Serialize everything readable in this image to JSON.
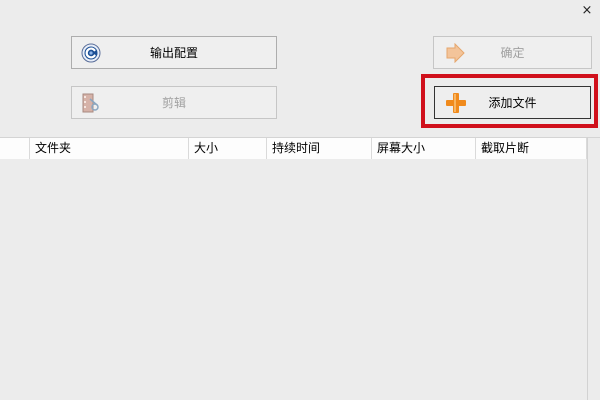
{
  "window": {
    "close_glyph": "×"
  },
  "buttons": {
    "output_config": {
      "label": "输出配置",
      "icon": "gear-circle-icon",
      "enabled": true
    },
    "confirm": {
      "label": "确定",
      "icon": "arrow-right-icon",
      "enabled": false
    },
    "cut": {
      "label": "剪辑",
      "icon": "film-scissors-icon",
      "enabled": false
    },
    "add_file": {
      "label": "添加文件",
      "icon": "plus-icon",
      "enabled": true,
      "highlighted": true
    }
  },
  "table": {
    "columns": [
      "",
      "文件夹",
      "大小",
      "持续时间",
      "屏幕大小",
      "截取片断"
    ],
    "rows": []
  },
  "colors": {
    "highlight": "#d0101b",
    "plus": "#f08a1c"
  }
}
